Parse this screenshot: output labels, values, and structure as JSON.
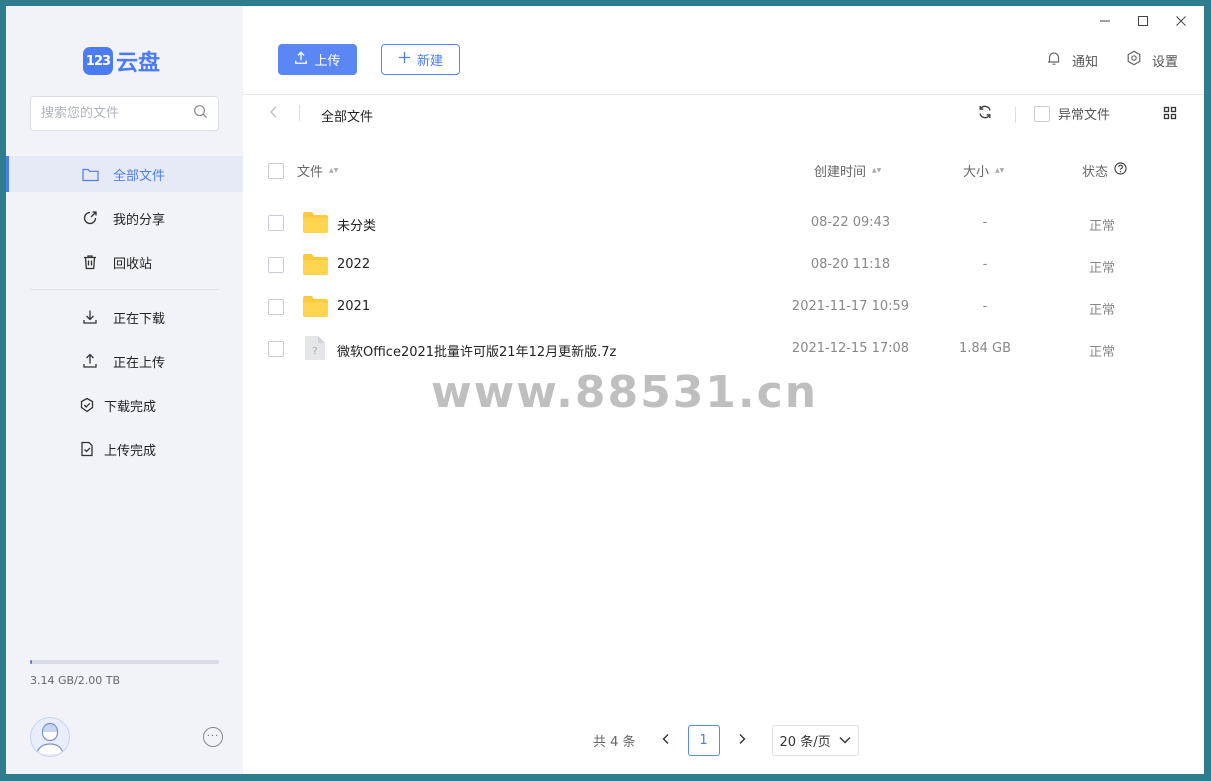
{
  "app": {
    "logo_badge": "123",
    "logo_text": "云盘",
    "accent": "#4c7cf3"
  },
  "search": {
    "placeholder": "搜索您的文件"
  },
  "sidebar": {
    "items": [
      {
        "label": "全部文件",
        "icon": "folder-icon",
        "active": true
      },
      {
        "label": "我的分享",
        "icon": "share-icon"
      },
      {
        "label": "回收站",
        "icon": "trash-icon"
      },
      {
        "label": "正在下载",
        "icon": "download-icon"
      },
      {
        "label": "正在上传",
        "icon": "upload-icon"
      },
      {
        "label": "下载完成",
        "icon": "check-circle-icon"
      },
      {
        "label": "上传完成",
        "icon": "file-check-icon"
      }
    ],
    "storage_text": "3.14 GB/2.00 TB",
    "storage_fraction": 0.0016
  },
  "toolbar": {
    "upload_label": "上传",
    "new_label": "新建",
    "notify_label": "通知",
    "settings_label": "设置"
  },
  "breadcrumb": {
    "current": "全部文件"
  },
  "filter": {
    "abnormal_label": "异常文件"
  },
  "table": {
    "headers": {
      "name": "文件",
      "time": "创建时间",
      "size": "大小",
      "status": "状态"
    },
    "rows": [
      {
        "name": "未分类",
        "time": "08-22 09:43",
        "size": "-",
        "status": "正常",
        "type": "folder"
      },
      {
        "name": "2022",
        "time": "08-20 11:18",
        "size": "-",
        "status": "正常",
        "type": "folder"
      },
      {
        "name": "2021",
        "time": "2021-11-17 10:59",
        "size": "-",
        "status": "正常",
        "type": "folder"
      },
      {
        "name": "微软Office2021批量许可版21年12月更新版.7z",
        "time": "2021-12-15 17:08",
        "size": "1.84 GB",
        "status": "正常",
        "type": "file"
      }
    ]
  },
  "watermark": "www.88531.cn",
  "pagination": {
    "count": "共 4 条",
    "page": "1",
    "page_size": "20 条/页"
  }
}
